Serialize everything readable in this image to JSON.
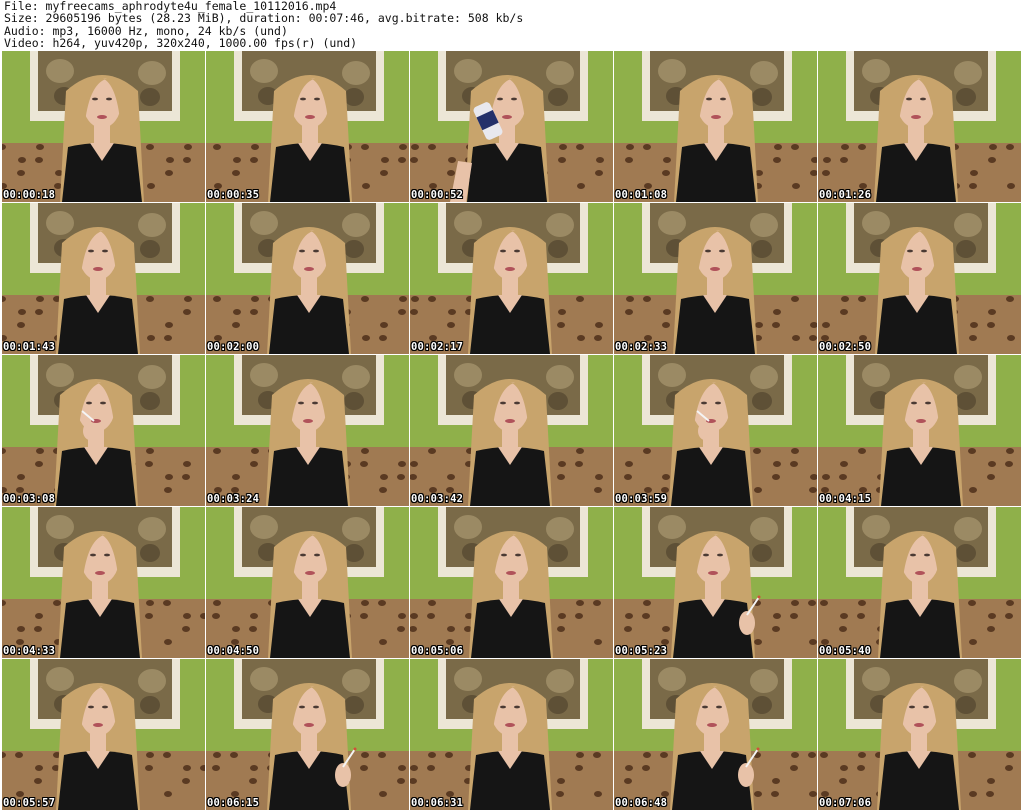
{
  "header": {
    "file_line": "File: myfreecams_aphrodyte4u_female_10112016.mp4",
    "size_line": "Size: 29605196 bytes (28.23 MiB), duration: 00:07:46, avg.bitrate: 508 kb/s",
    "audio_line": "Audio: mp3, 16000 Hz, mono, 24 kb/s (und)",
    "video_line": "Video: h264, yuv420p, 320x240, 1000.00 fps(r) (und)"
  },
  "colors": {
    "wall": "#8fb04a",
    "frame": "#ece6d6",
    "painting": "#7a6a48",
    "couch": "#a07a52",
    "hair": "#c8a46c",
    "skin": "#e8c2a8",
    "top": "#151515"
  },
  "thumbnails": [
    {
      "time": "00:00:18",
      "prop": "none"
    },
    {
      "time": "00:00:35",
      "prop": "none"
    },
    {
      "time": "00:00:52",
      "prop": "can"
    },
    {
      "time": "00:01:08",
      "prop": "none"
    },
    {
      "time": "00:01:26",
      "prop": "none"
    },
    {
      "time": "00:01:43",
      "prop": "none"
    },
    {
      "time": "00:02:00",
      "prop": "none"
    },
    {
      "time": "00:02:17",
      "prop": "none"
    },
    {
      "time": "00:02:33",
      "prop": "none"
    },
    {
      "time": "00:02:50",
      "prop": "none"
    },
    {
      "time": "00:03:08",
      "prop": "cigarette-mouth"
    },
    {
      "time": "00:03:24",
      "prop": "none"
    },
    {
      "time": "00:03:42",
      "prop": "none"
    },
    {
      "time": "00:03:59",
      "prop": "cigarette-mouth"
    },
    {
      "time": "00:04:15",
      "prop": "none"
    },
    {
      "time": "00:04:33",
      "prop": "none"
    },
    {
      "time": "00:04:50",
      "prop": "none"
    },
    {
      "time": "00:05:06",
      "prop": "none"
    },
    {
      "time": "00:05:23",
      "prop": "cigarette-hand"
    },
    {
      "time": "00:05:40",
      "prop": "none"
    },
    {
      "time": "00:05:57",
      "prop": "none"
    },
    {
      "time": "00:06:15",
      "prop": "cigarette-hand"
    },
    {
      "time": "00:06:31",
      "prop": "none"
    },
    {
      "time": "00:06:48",
      "prop": "cigarette-hand"
    },
    {
      "time": "00:07:06",
      "prop": "none"
    }
  ]
}
